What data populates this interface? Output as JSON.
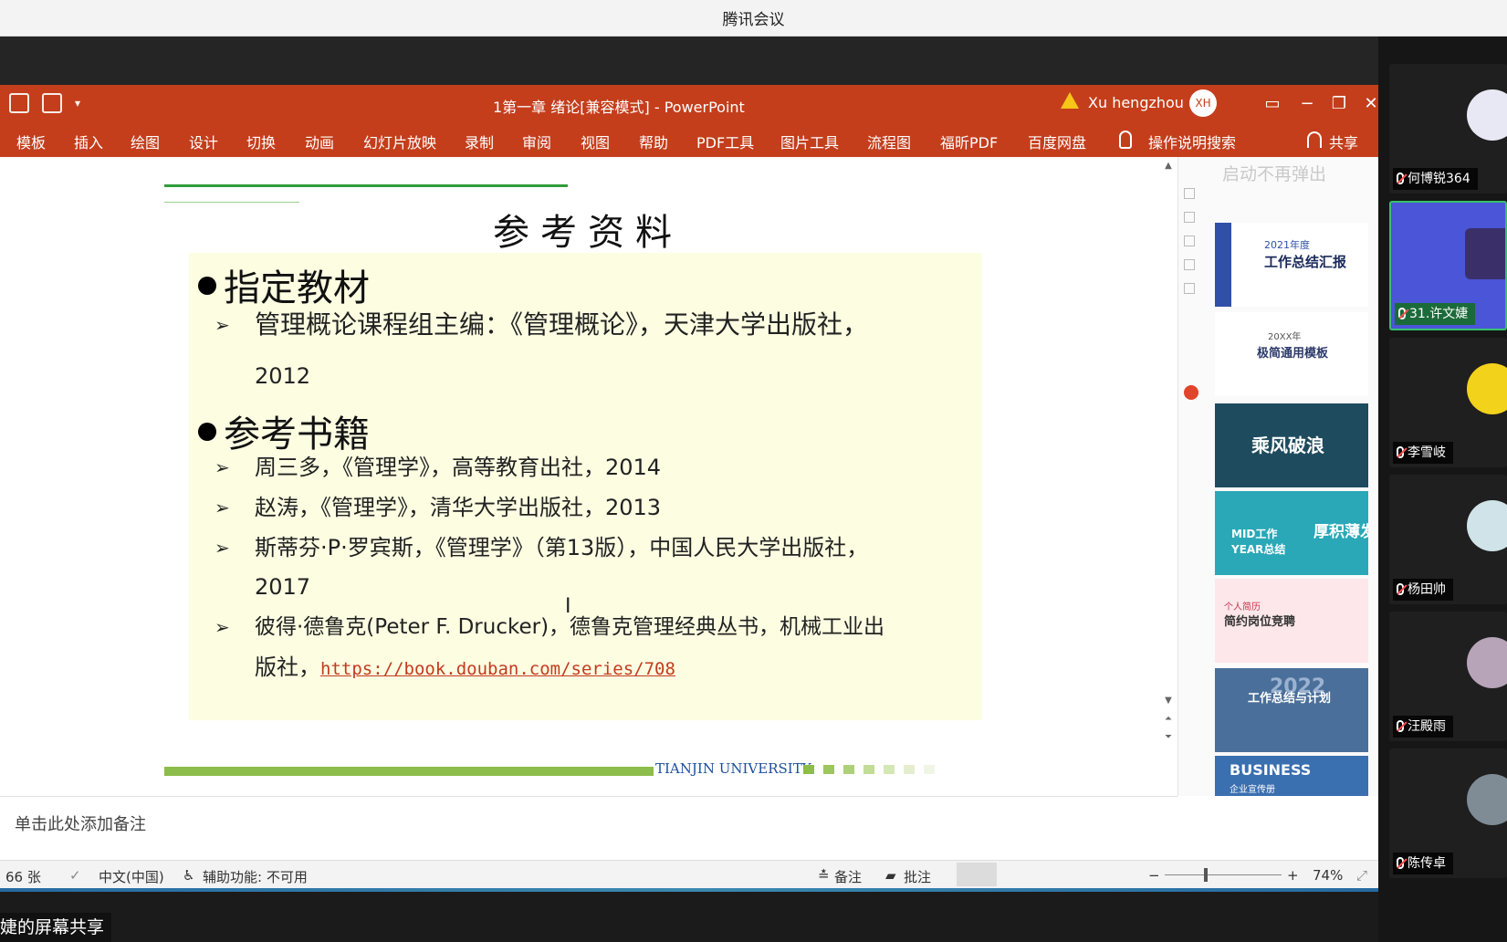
{
  "meeting": {
    "title": "腾讯会议",
    "share_label": "婕的屏幕共享"
  },
  "ppt": {
    "doc_title": "1第一章 绪论[兼容模式]  -  PowerPoint",
    "user": {
      "name": "Xu hengzhou",
      "initials": "XH"
    },
    "ribbon_tabs": [
      "模板",
      "插入",
      "绘图",
      "设计",
      "切换",
      "动画",
      "幻灯片放映",
      "录制",
      "审阅",
      "视图",
      "帮助",
      "PDF工具",
      "图片工具",
      "流程图",
      "福昕PDF",
      "百度网盘"
    ],
    "tell_me": "操作说明搜索",
    "share": "共享"
  },
  "slide": {
    "title": "参考资料",
    "section1": "指定教材",
    "s1_item1_line1": "管理概论课程组主编：《管理概论》，天津大学出版社，",
    "s1_item1_line2": "2012",
    "section2": "参考书籍",
    "s2_item1": "周三多，《管理学》，高等教育出社，2014",
    "s2_item2": "赵涛，《管理学》，清华大学出版社，2013",
    "s2_item3_line1": "斯蒂芬·P·罗宾斯，《管理学》（第13版），中国人民大学出版社，",
    "s2_item3_line2": "2017",
    "s2_item4_line1": "彼得·德鲁克(Peter F. Drucker)，德鲁克管理经典丛书，机械工业出",
    "s2_item4_line2_prefix": "版社，",
    "s2_item4_link": "https://book.douban.com/series/708",
    "footer_university": "TIANJIN UNIVERSITY"
  },
  "design_panel": {
    "no_popup": "启动不再弹出",
    "thumbs": [
      {
        "title": "工作总结汇报",
        "subtitle": "2021年度"
      },
      {
        "title": "极简通用模板",
        "subtitle": "20XX年"
      },
      {
        "title": "乘风破浪",
        "subtitle": ""
      },
      {
        "title": "MID工作 YEAR总结",
        "subtitle": "厚积薄发"
      },
      {
        "title": "简约岗位竞聘",
        "subtitle": "个人简历"
      },
      {
        "title": "工作总结与计划",
        "subtitle": "2022"
      },
      {
        "title": "BUSINESS",
        "subtitle": "企业宣传册"
      }
    ]
  },
  "notes_placeholder": "单击此处添加备注",
  "status": {
    "slide_count": "66 张",
    "language": "中文(中国)",
    "accessibility": "辅助功能: 不可用",
    "notes_btn": "备注",
    "comments_btn": "批注",
    "zoom_minus": "−",
    "zoom_plus": "+",
    "zoom": "74%"
  },
  "participants": [
    {
      "name": "何博锐364",
      "mic": "muted"
    },
    {
      "name": "31.许文婕",
      "mic": "on",
      "active": true
    },
    {
      "name": "李雪岐",
      "mic": "muted"
    },
    {
      "name": "杨田帅",
      "mic": "muted"
    },
    {
      "name": "汪殿雨",
      "mic": "muted"
    },
    {
      "name": "陈传卓",
      "mic": "muted"
    }
  ],
  "colors": {
    "ppt_red": "#c43e1c",
    "slide_box": "#fdfde2",
    "tju_blue": "#1c4f9c",
    "tju_green": "#8cbc4a"
  }
}
